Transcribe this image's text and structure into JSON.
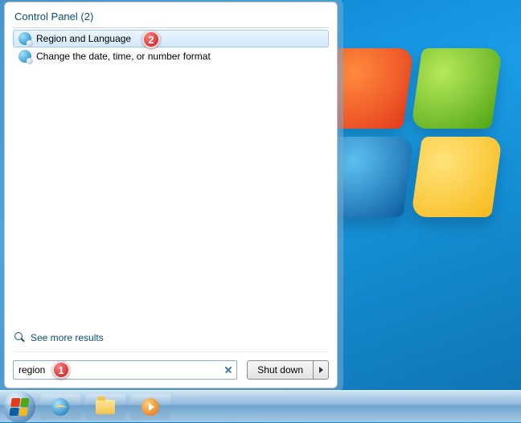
{
  "desktop": {},
  "start_menu": {
    "category_header": "Control Panel (2)",
    "results": [
      {
        "label": "Region and Language",
        "selected": true
      },
      {
        "label": "Change the date, time, or number format",
        "selected": false
      }
    ],
    "see_more_label": "See more results",
    "search_value": "region",
    "shutdown_label": "Shut down"
  },
  "annotations": {
    "badge1": "1",
    "badge2": "2"
  },
  "taskbar": {}
}
